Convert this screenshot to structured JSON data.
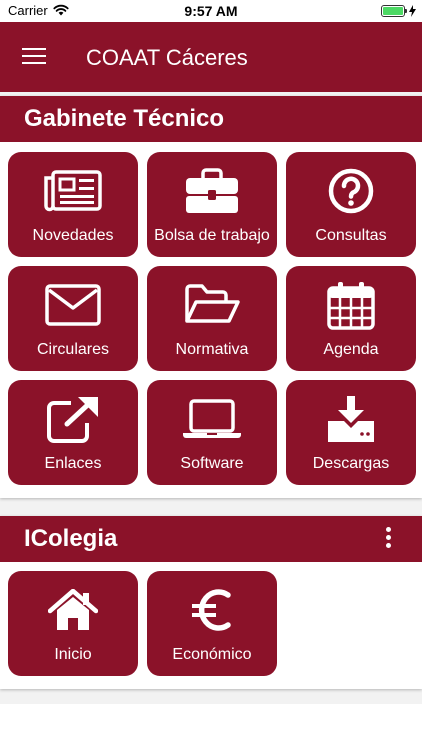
{
  "status_bar": {
    "carrier": "Carrier",
    "time": "9:57 AM",
    "battery_level": 1.0
  },
  "app_bar": {
    "title": "COAAT Cáceres",
    "menu_icon": "hamburger-menu-icon"
  },
  "section_gabinete": {
    "title": "Gabinete Técnico",
    "tiles": [
      {
        "label": "Novedades",
        "icon": "newspaper-icon"
      },
      {
        "label": "Bolsa de trabajo",
        "icon": "briefcase-icon"
      },
      {
        "label": "Consultas",
        "icon": "question-circle-icon"
      },
      {
        "label": "Circulares",
        "icon": "envelope-icon"
      },
      {
        "label": "Normativa",
        "icon": "folder-open-icon"
      },
      {
        "label": "Agenda",
        "icon": "calendar-icon"
      },
      {
        "label": "Enlaces",
        "icon": "external-link-icon"
      },
      {
        "label": "Software",
        "icon": "laptop-icon"
      },
      {
        "label": "Descargas",
        "icon": "download-icon"
      }
    ]
  },
  "section_icolegia": {
    "title": "IColegia",
    "overflow_icon": "more-vertical-icon",
    "tiles": [
      {
        "label": "Inicio",
        "icon": "home-icon"
      },
      {
        "label": "Económico",
        "icon": "euro-icon"
      }
    ]
  },
  "colors": {
    "brand": "#8b1229",
    "background": "#f2f2f2",
    "tile_text": "#ffffff"
  }
}
